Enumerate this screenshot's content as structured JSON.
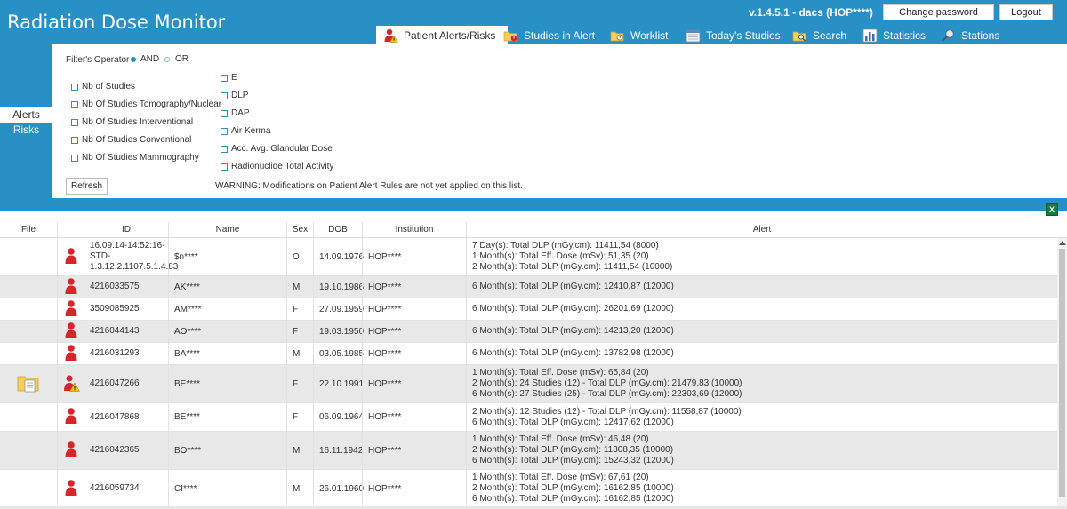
{
  "app": {
    "title": "Radiation Dose Monitor",
    "version": "v.1.4.5.1  -   dacs (HOP****)",
    "change_password": "Change password",
    "logout": "Logout"
  },
  "tabs": [
    {
      "label": "Patient Alerts/Risks",
      "icon": "patient-alert-icon",
      "active": true
    },
    {
      "label": "Studies in Alert",
      "icon": "folder-alert-icon"
    },
    {
      "label": "Worklist",
      "icon": "worklist-icon"
    },
    {
      "label": "Today's Studies",
      "icon": "calendar-icon"
    },
    {
      "label": "Search",
      "icon": "search-folder-icon"
    },
    {
      "label": "Statistics",
      "icon": "bar-chart-icon"
    },
    {
      "label": "Stations",
      "icon": "magnifier-icon"
    }
  ],
  "sidebar": {
    "alerts": "Alerts",
    "risks": "Risks"
  },
  "filter": {
    "operator_label": "Filter's Operator",
    "and": "AND",
    "or": "OR",
    "left_checks": [
      "Nb of Studies",
      "Nb Of Studies Tomography/Nuclear",
      "Nb Of Studies Interventional",
      "Nb Of Studies Conventional",
      "Nb Of Studies Mammography"
    ],
    "right_checks": [
      "E",
      "DLP",
      "DAP",
      "Air Kerma",
      "Acc. Avg. Glandular Dose",
      "Radionuclide Total Activity"
    ],
    "refresh": "Refresh",
    "warning": "WARNING: Modifications on Patient Alert Rules are not yet applied on this list."
  },
  "export_icon": "excel-icon",
  "table": {
    "headers": [
      "File",
      "ID",
      "Name",
      "Sex",
      "DOB",
      "Institution",
      "Alert"
    ],
    "rows": [
      {
        "file": false,
        "status": "red",
        "id": [
          "16.09.14-14:52:16-",
          "STD-",
          "1.3.12.2.1107.5.1.4.83"
        ],
        "name": "$n****",
        "sex": "O",
        "dob": "14.09.1976",
        "inst": "HOP****",
        "alerts": [
          "7 Day(s): Total DLP (mGy.cm): 11411,54 (8000)",
          "1 Month(s): Total Eff. Dose (mSv): 51,35 (20)",
          "2 Month(s): Total DLP (mGy.cm): 11411,54 (10000)"
        ]
      },
      {
        "file": false,
        "status": "red",
        "id": [
          "4216033575"
        ],
        "name": "AK****",
        "sex": "M",
        "dob": "19.10.1986",
        "inst": "HOP****",
        "alerts": [
          "6 Month(s): Total DLP (mGy.cm): 12410,87 (12000)"
        ]
      },
      {
        "file": false,
        "status": "red",
        "id": [
          "3509085925"
        ],
        "name": "AM****",
        "sex": "F",
        "dob": "27.09.1959",
        "inst": "HOP****",
        "alerts": [
          "6 Month(s): Total DLP (mGy.cm): 26201,69 (12000)"
        ]
      },
      {
        "file": false,
        "status": "red",
        "id": [
          "4216044143"
        ],
        "name": "AO****",
        "sex": "F",
        "dob": "19.03.1950",
        "inst": "HOP****",
        "alerts": [
          "6 Month(s): Total DLP (mGy.cm): 14213,20 (12000)"
        ]
      },
      {
        "file": false,
        "status": "red",
        "id": [
          "4216031293"
        ],
        "name": "BA****",
        "sex": "M",
        "dob": "03.05.1985",
        "inst": "HOP****",
        "alerts": [
          "6 Month(s): Total DLP (mGy.cm): 13782,98 (12000)"
        ]
      },
      {
        "file": true,
        "status": "warning",
        "id": [
          "4216047266"
        ],
        "name": "BE****",
        "sex": "F",
        "dob": "22.10.1991",
        "inst": "HOP****",
        "alerts": [
          "1 Month(s): Total Eff. Dose (mSv): 65,84 (20)",
          "2 Month(s): 24 Studies (12) - Total DLP (mGy.cm): 21479,83 (10000)",
          "6 Month(s): 27 Studies (25) - Total DLP (mGy.cm): 22303,69 (12000)"
        ]
      },
      {
        "file": false,
        "status": "red",
        "id": [
          "4216047868"
        ],
        "name": "BE****",
        "sex": "F",
        "dob": "06.09.1964",
        "inst": "HOP****",
        "alerts": [
          "2 Month(s): 12 Studies (12) - Total DLP (mGy.cm): 11558,87 (10000)",
          "6 Month(s): Total DLP (mGy.cm): 12417,62 (12000)"
        ]
      },
      {
        "file": false,
        "status": "red",
        "id": [
          "4216042365"
        ],
        "name": "BO****",
        "sex": "M",
        "dob": "16.11.1942",
        "inst": "HOP****",
        "alerts": [
          "1 Month(s): Total Eff. Dose (mSv): 46,48 (20)",
          "2 Month(s): Total DLP (mGy.cm): 11308,35 (10000)",
          "6 Month(s): Total DLP (mGy.cm): 15243,32 (12000)"
        ]
      },
      {
        "file": false,
        "status": "red",
        "id": [
          "4216059734"
        ],
        "name": "CI****",
        "sex": "M",
        "dob": "26.01.1960",
        "inst": "HOP****",
        "alerts": [
          "1 Month(s): Total Eff. Dose (mSv): 67,61 (20)",
          "2 Month(s): Total DLP (mGy.cm): 16162,85 (10000)",
          "6 Month(s): Total DLP (mGy.cm): 16162,85 (12000)"
        ]
      }
    ]
  },
  "colors": {
    "brand": "#2791c5",
    "alert_red": "#d7262b",
    "warning_yellow": "#f2c21b"
  }
}
